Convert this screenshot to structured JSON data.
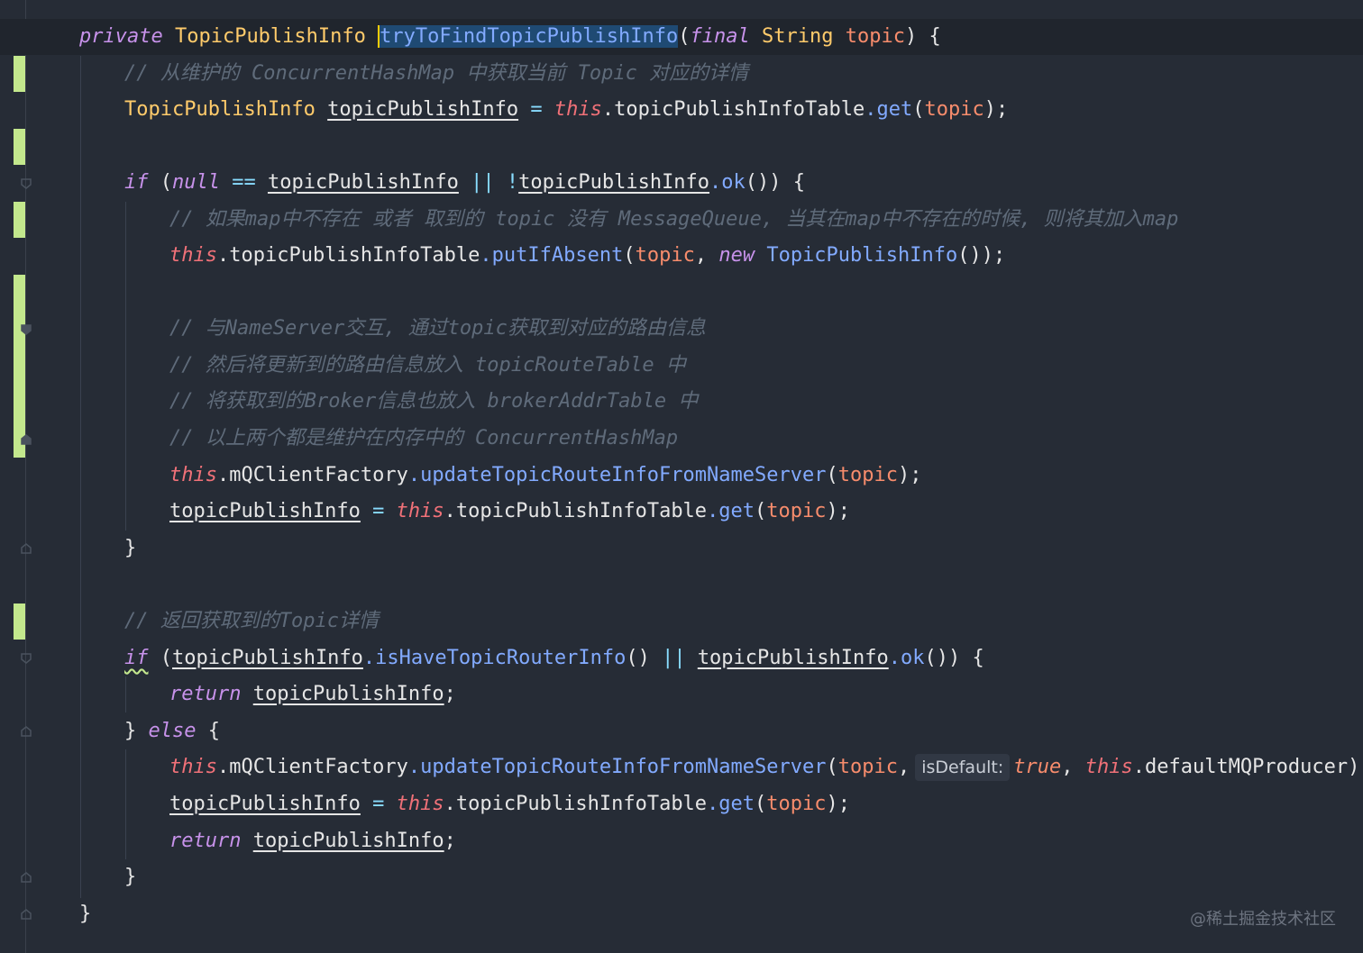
{
  "editor": {
    "sig": {
      "private": "private",
      "ret_type": "TopicPublishInfo",
      "method": "tryToFindTopicPublishInfo",
      "paren_open": "(",
      "final": "final",
      "string": "String",
      "param": "topic",
      "tail": ") {"
    },
    "c1": "// 从维护的 ConcurrentHashMap 中获取当前 Topic 对应的详情",
    "decl": {
      "type": "TopicPublishInfo",
      "var": "topicPublishInfo",
      "eq": " = ",
      "this": "this",
      "field": ".topicPublishInfoTable",
      "method": ".get",
      "open": "(",
      "arg": "topic",
      "close": ");"
    },
    "if1": {
      "kw": "if",
      "open": " (",
      "null": "null",
      "eq": " == ",
      "var1": "topicPublishInfo",
      "or": " || ",
      "not": "!",
      "var2": "topicPublishInfo",
      "method": ".ok",
      "close": "()) {"
    },
    "c2": "// 如果map中不存在 或者 取到的 topic 没有 MessageQueue, 当其在map中不存在的时候, 则将其加入map",
    "put": {
      "this": "this",
      "field": ".topicPublishInfoTable",
      "method": ".putIfAbsent",
      "open": "(",
      "arg": "topic",
      "comma": ", ",
      "new": "new",
      "ctor": " TopicPublishInfo",
      "close": "());"
    },
    "c3": "// 与NameServer交互, 通过topic获取到对应的路由信息",
    "c4": "// 然后将更新到的路由信息放入 topicRouteTable 中",
    "c5": "// 将获取到的Broker信息也放入 brokerAddrTable 中",
    "c6": "// 以上两个都是维护在内存中的 ConcurrentHashMap",
    "upd1": {
      "this": "this",
      "field": ".mQClientFactory",
      "method": ".updateTopicRouteInfoFromNameServer",
      "open": "(",
      "arg": "topic",
      "close": ");"
    },
    "reassign1": {
      "var": "topicPublishInfo",
      "eq": " = ",
      "this": "this",
      "field": ".topicPublishInfoTable",
      "method": ".get",
      "open": "(",
      "arg": "topic",
      "close": ");"
    },
    "close1": "}",
    "c7": "// 返回获取到的Topic详情",
    "if2": {
      "kw": "if",
      "open": " (",
      "var1": "topicPublishInfo",
      "method1": ".isHaveTopicRouterInfo",
      "call1": "()",
      "or": " || ",
      "var2": "topicPublishInfo",
      "method2": ".ok",
      "close": "()) {"
    },
    "ret1": {
      "kw": "return",
      "var": "topicPublishInfo",
      "semi": ";"
    },
    "else": {
      "brace1": "} ",
      "kw": "else",
      "brace2": " {"
    },
    "upd2": {
      "this": "this",
      "field": ".mQClientFactory",
      "method": ".updateTopicRouteInfoFromNameServer",
      "open": "(",
      "arg": "topic",
      "comma": ",",
      "hint": "isDefault:",
      "true": "true",
      "comma2": ", ",
      "this2": "this",
      "field2": ".defaultMQProducer",
      "close": ");"
    },
    "reassign2": {
      "var": "topicPublishInfo",
      "eq": " = ",
      "this": "this",
      "field": ".topicPublishInfoTable",
      "method": ".get",
      "open": "(",
      "arg": "topic",
      "close": ");"
    },
    "ret2": {
      "kw": "return",
      "var": "topicPublishInfo",
      "semi": ";"
    },
    "close2": "}",
    "close3": "}"
  },
  "watermark": "@稀土掘金技术社区",
  "colors": {
    "background": "#262c36",
    "keyword": "#c792ea",
    "this": "#f07178",
    "type": "#ffcb6b",
    "method": "#82aaff",
    "param": "#f78c6c",
    "comment": "#5f6b7a",
    "change_marker": "#c3e88d"
  }
}
